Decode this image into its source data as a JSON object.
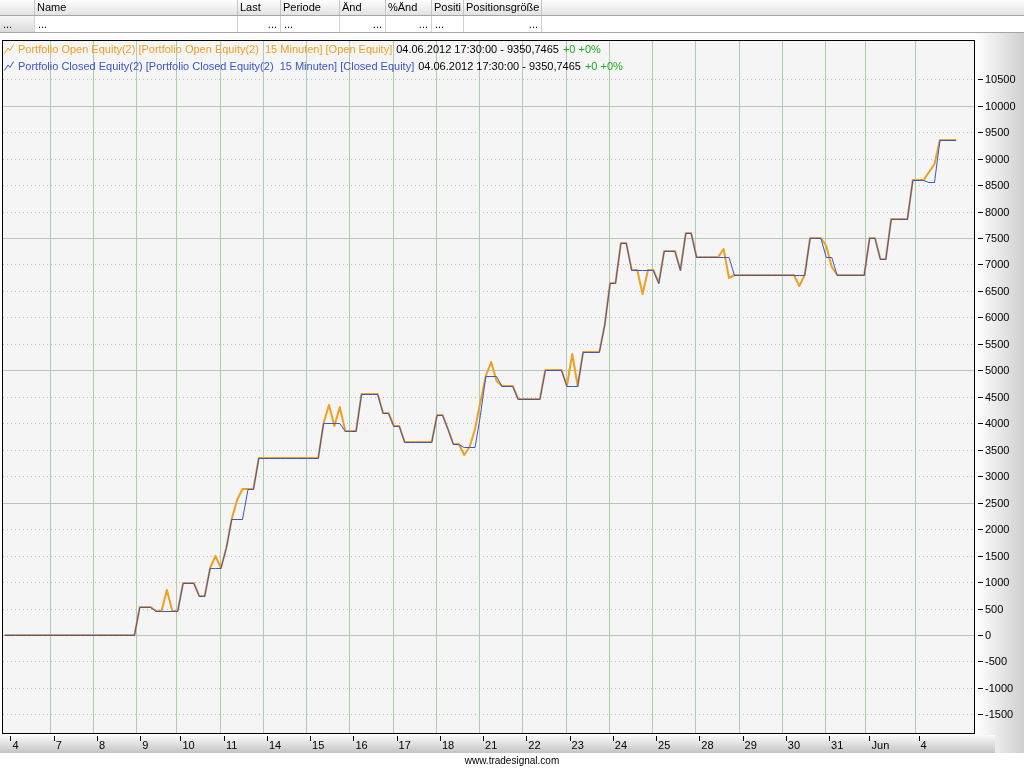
{
  "table": {
    "columns": [
      "Name",
      "Last",
      "Periode",
      "Änd",
      "%Änd",
      "Positi",
      "Positionsgröße"
    ],
    "rows": [
      {
        "header": "...",
        "cells": [
          "...",
          "...",
          "...",
          "...",
          "...",
          "...",
          "..."
        ]
      }
    ]
  },
  "chart": {
    "readings": [
      {
        "reading": "04.06.2012 17:30:00 - 9350,7465",
        "change": "+0 +0%"
      },
      {
        "reading": "04.06.2012 17:30:00 - 9350,7465",
        "change": "+0 +0%"
      }
    ],
    "chart_data": {
      "type": "line",
      "grid": true,
      "legend": "upper left",
      "categories": [
        null,
        null,
        "4",
        null,
        null,
        null,
        null,
        null,
        null,
        null,
        "7",
        null,
        null,
        null,
        null,
        null,
        null,
        null,
        "8",
        null,
        null,
        null,
        null,
        null,
        null,
        null,
        "9",
        null,
        null,
        null,
        null,
        null,
        null,
        null,
        "10",
        null,
        null,
        null,
        null,
        null,
        null,
        null,
        "11",
        null,
        null,
        null,
        null,
        null,
        null,
        null,
        "14",
        null,
        null,
        null,
        null,
        null,
        null,
        null,
        "15",
        null,
        null,
        null,
        null,
        null,
        null,
        null,
        "16",
        null,
        null,
        null,
        null,
        null,
        null,
        null,
        "17",
        null,
        null,
        null,
        null,
        null,
        null,
        null,
        "18",
        null,
        null,
        null,
        null,
        null,
        null,
        null,
        "21",
        null,
        null,
        null,
        null,
        null,
        null,
        null,
        "22",
        null,
        null,
        null,
        null,
        null,
        null,
        null,
        "23",
        null,
        null,
        null,
        null,
        null,
        null,
        null,
        "24",
        null,
        null,
        null,
        null,
        null,
        null,
        null,
        "25",
        null,
        null,
        null,
        null,
        null,
        null,
        null,
        "28",
        null,
        null,
        null,
        null,
        null,
        null,
        null,
        "29",
        null,
        null,
        null,
        null,
        null,
        null,
        null,
        "30",
        null,
        null,
        null,
        null,
        null,
        null,
        null,
        "31",
        null,
        null,
        null,
        null,
        null,
        null,
        null,
        "Jun",
        null,
        null,
        null,
        null,
        null,
        null,
        null,
        "4",
        null,
        null,
        null,
        null,
        null,
        null,
        null,
        null,
        null
      ],
      "series": [
        {
          "name": "Portfolio Open Equity(2) [Portfolio Open Equity(2)  15 Minuten] [Open Equity]",
          "color": "#f0a020",
          "values": [
            0,
            0,
            0,
            0,
            0,
            0,
            0,
            0,
            0,
            0,
            0,
            0,
            0,
            0,
            0,
            0,
            0,
            0,
            0,
            0,
            0,
            0,
            0,
            0,
            0,
            520,
            520,
            520,
            460,
            460,
            850,
            460,
            460,
            990,
            990,
            990,
            730,
            730,
            1270,
            1500,
            1270,
            1650,
            2200,
            2550,
            2750,
            2750,
            2750,
            3350,
            3350,
            3350,
            3350,
            3350,
            3350,
            3350,
            3350,
            3350,
            3350,
            3350,
            3350,
            4000,
            4350,
            3950,
            4300,
            3850,
            3850,
            3850,
            4560,
            4560,
            4560,
            4560,
            4200,
            4200,
            3950,
            3950,
            3650,
            3650,
            3650,
            3650,
            3650,
            3650,
            4150,
            4150,
            3900,
            3600,
            3600,
            3400,
            3550,
            3900,
            4400,
            4900,
            5150,
            4800,
            4700,
            4700,
            4700,
            4450,
            4450,
            4450,
            4450,
            4450,
            5000,
            5000,
            5000,
            5000,
            4700,
            5300,
            4700,
            5350,
            5350,
            5350,
            5350,
            5850,
            6650,
            6650,
            7400,
            7400,
            6900,
            6900,
            6450,
            6900,
            6900,
            6650,
            7250,
            7250,
            7250,
            6900,
            7600,
            7600,
            7150,
            7150,
            7150,
            7150,
            7150,
            7300,
            6750,
            6800,
            6800,
            6800,
            6800,
            6800,
            6800,
            6800,
            6800,
            6800,
            6800,
            6800,
            6800,
            6600,
            6800,
            7500,
            7500,
            7500,
            7350,
            6950,
            6800,
            6800,
            6800,
            6800,
            6800,
            6800,
            7500,
            7500,
            7100,
            7100,
            7850,
            7850,
            7850,
            7850,
            8600,
            8600,
            8600,
            8750,
            8900,
            9350,
            9350,
            9350,
            9350,
            null,
            null,
            null
          ]
        },
        {
          "name": "Portfolio Closed Equity(2) [Portfolio Closed Equity(2)  15 Minuten] [Closed Equity]",
          "color": "#3a56c8",
          "values": [
            0,
            0,
            0,
            0,
            0,
            0,
            0,
            0,
            0,
            0,
            0,
            0,
            0,
            0,
            0,
            0,
            0,
            0,
            0,
            0,
            0,
            0,
            0,
            0,
            0,
            520,
            520,
            520,
            460,
            460,
            460,
            460,
            460,
            990,
            990,
            990,
            730,
            730,
            1270,
            1270,
            1270,
            1650,
            2200,
            2200,
            2200,
            2750,
            2750,
            3350,
            3350,
            3350,
            3350,
            3350,
            3350,
            3350,
            3350,
            3350,
            3350,
            3350,
            3350,
            4000,
            4000,
            4000,
            4000,
            3850,
            3850,
            3850,
            4560,
            4560,
            4560,
            4560,
            4200,
            4200,
            3950,
            3950,
            3650,
            3650,
            3650,
            3650,
            3650,
            3650,
            4150,
            4150,
            3900,
            3600,
            3600,
            3550,
            3550,
            3550,
            4150,
            4900,
            4900,
            4900,
            4700,
            4700,
            4700,
            4450,
            4450,
            4450,
            4450,
            4450,
            5000,
            5000,
            5000,
            5000,
            4700,
            4700,
            4700,
            5350,
            5350,
            5350,
            5350,
            5850,
            6650,
            6650,
            7400,
            7400,
            6900,
            6900,
            6900,
            6900,
            6900,
            6650,
            7250,
            7250,
            7250,
            6900,
            7600,
            7600,
            7150,
            7150,
            7150,
            7150,
            7150,
            7150,
            7150,
            6800,
            6800,
            6800,
            6800,
            6800,
            6800,
            6800,
            6800,
            6800,
            6800,
            6800,
            6800,
            6800,
            6800,
            7500,
            7500,
            7500,
            7150,
            7150,
            6800,
            6800,
            6800,
            6800,
            6800,
            6800,
            7500,
            7500,
            7100,
            7100,
            7850,
            7850,
            7850,
            7850,
            8600,
            8600,
            8600,
            8550,
            8550,
            9350,
            9350,
            9350,
            9350,
            null,
            null,
            null
          ]
        }
      ],
      "ylim": [
        -1870,
        11240
      ],
      "yticks": [
        -1500,
        -1000,
        -500,
        0,
        500,
        1000,
        1500,
        2000,
        2500,
        3000,
        3500,
        4000,
        4500,
        5000,
        5500,
        6000,
        6500,
        7000,
        7500,
        8000,
        8500,
        9000,
        9500,
        10000,
        10500
      ]
    }
  },
  "footer": {
    "text": "www.tradesignal.com"
  }
}
